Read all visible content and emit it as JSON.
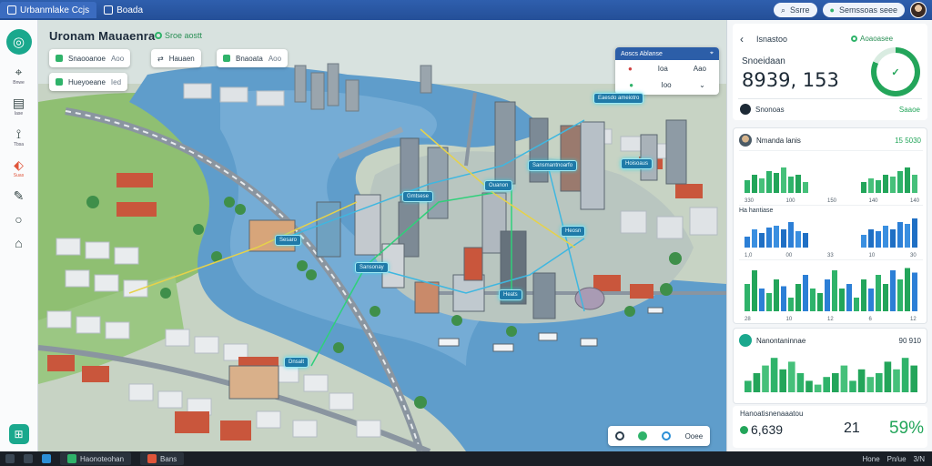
{
  "browser": {
    "tabs": [
      {
        "label": "Urbanmlake Ccjs"
      },
      {
        "label": "Boada"
      }
    ],
    "search_label": "Ssrre",
    "account_label": "Semssoas seee"
  },
  "rail": {
    "items": [
      {
        "icon": "pin-icon",
        "label": "Bnwe"
      },
      {
        "icon": "doc-icon",
        "label": "Iase"
      },
      {
        "icon": "route-icon",
        "label": "Tbsa"
      },
      {
        "icon": "tag-icon",
        "label": "Suas"
      },
      {
        "icon": "pen-icon",
        "label": ""
      },
      {
        "icon": "circle-icon",
        "label": ""
      },
      {
        "icon": "home-icon",
        "label": ""
      }
    ]
  },
  "map": {
    "title": "Uronam Mauaenra",
    "status": "Sroe aostt",
    "chips": [
      {
        "label": "Snaooanoe",
        "sub": "Aoo"
      },
      {
        "label": "Hauaen",
        "sub": ""
      },
      {
        "label": "Bnaoata",
        "sub": "Aoo"
      },
      {
        "label": "Hueyoeane",
        "sub": "Ied"
      }
    ],
    "legend": {
      "title": "Aoscs Ablanse",
      "v1": "Ioa",
      "v2": "Aao",
      "v3": "Ioo"
    },
    "pins": [
      "Sansmantnoarfo",
      "Hoisoaus",
      "Gmtsese",
      "Sesaro",
      "Heosn",
      "Sansonay",
      "Heats",
      "Dnsalt",
      "Ouanon",
      "Eaesdo ameiotro"
    ],
    "toolbar": {
      "label": "Ooee"
    }
  },
  "panel": {
    "header": "Isnastoo",
    "live": "Aoaoasee",
    "subtitle": "Snoeidaan",
    "big_value": "8939, 153",
    "ring_pct": "82",
    "row_label": "Snonoas",
    "row_action": "Saaoe",
    "card1": {
      "title": "Nmanda lanis",
      "values": "15 5030"
    },
    "sub1": {
      "label": "",
      "ticks": [
        "330",
        "100",
        "150",
        "140",
        "140"
      ]
    },
    "sub2": {
      "label": "Ha hantiase",
      "ticks": [
        "1,0",
        "00",
        "33",
        "10",
        "30"
      ]
    },
    "sub3": {
      "label": "",
      "ticks": [
        "28",
        "10",
        "12",
        "6",
        "12"
      ]
    },
    "card2": {
      "title": "Nanontaninnae",
      "values": "90 910"
    },
    "summary": {
      "label": "Hanoatisnenaaatou",
      "v1": "6,639",
      "v2": "21",
      "v3": "59%"
    }
  },
  "taskbar": {
    "app1": "Haonoteohan",
    "app2": "Bans",
    "tray": [
      "Hone",
      "Pn/ue",
      "3/N"
    ]
  }
}
